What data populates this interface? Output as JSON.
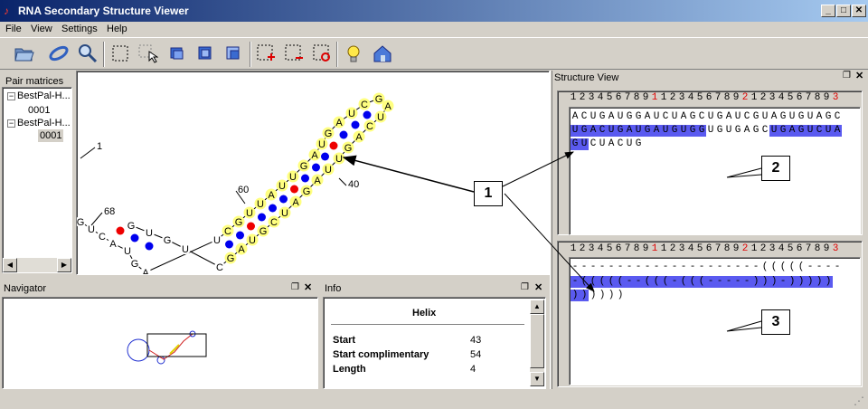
{
  "window": {
    "title": "RNA Secondary Structure Viewer",
    "minimize": "_",
    "maximize": "□",
    "close": "✕"
  },
  "menu": [
    "File",
    "View",
    "Settings",
    "Help"
  ],
  "toolbar": {
    "tools": [
      "open",
      "link",
      "search",
      "select-rect",
      "pointer",
      "window-1",
      "window-2",
      "window-3",
      "add-region",
      "remove-region",
      "refresh-region",
      "hint",
      "home"
    ]
  },
  "pair_matrices": {
    "title": "Pair matrices",
    "items": [
      {
        "label": "BestPal-H...",
        "child": "0001"
      },
      {
        "label": "BestPal-H...",
        "child": "0001"
      }
    ]
  },
  "structure_canvas": {
    "labels": [
      "1",
      "68",
      "60",
      "40"
    ],
    "bases": [
      {
        "t": "G"
      },
      {
        "t": "U"
      },
      {
        "t": "C"
      },
      {
        "t": "A"
      },
      {
        "t": "U"
      },
      {
        "t": "G"
      },
      {
        "t": "A"
      },
      {
        "t": "U"
      },
      {
        "t": "C"
      },
      {
        "t": "G"
      },
      {
        "t": "U"
      },
      {
        "t": "U"
      },
      {
        "t": "A"
      },
      {
        "t": "U"
      },
      {
        "t": "U"
      },
      {
        "t": "G"
      },
      {
        "t": "A"
      },
      {
        "t": "U"
      },
      {
        "t": "G"
      },
      {
        "t": "A"
      },
      {
        "t": "U"
      },
      {
        "t": "C"
      },
      {
        "t": "G"
      },
      {
        "t": "A"
      },
      {
        "t": "U"
      },
      {
        "t": "C"
      },
      {
        "t": "A"
      },
      {
        "t": "G"
      },
      {
        "t": "U"
      },
      {
        "t": "U"
      },
      {
        "t": "A"
      },
      {
        "t": "G"
      },
      {
        "t": "A"
      },
      {
        "t": "U"
      },
      {
        "t": "C"
      },
      {
        "t": "G"
      },
      {
        "t": "U"
      },
      {
        "t": "A"
      },
      {
        "t": "G"
      },
      {
        "t": "C"
      },
      {
        "t": "U"
      },
      {
        "t": "G"
      },
      {
        "t": "U"
      },
      {
        "t": "G"
      }
    ]
  },
  "navigator": {
    "title": "Navigator"
  },
  "info": {
    "title": "Info",
    "heading": "Helix",
    "rows": [
      {
        "label": "Start",
        "value": "43"
      },
      {
        "label": "Start complimentary",
        "value": "54"
      },
      {
        "label": "Length",
        "value": "4"
      }
    ]
  },
  "structure_view": {
    "title": "Structure View",
    "ruler": "1234567891123456789212345678 93",
    "sequence_lines": [
      "ACUGAUGGAUCUAGCUGAUCGUAGUGUAGC",
      "UGACUGAUGAUGUGGUGUGAGCUGAGUCUA",
      "GUCUACUG"
    ],
    "structure_lines": [
      "---------------------(((((----",
      "-(((((--(((-(((-----)))-)))))",
      "))))))"
    ]
  },
  "callouts": [
    "1",
    "2",
    "3"
  ],
  "colors": {
    "highlight": "#5a5af0",
    "base_fill": "#ffff80",
    "pair_blue": "#0000ee",
    "pair_red": "#ee0000",
    "ruler_red": "#e00000"
  }
}
